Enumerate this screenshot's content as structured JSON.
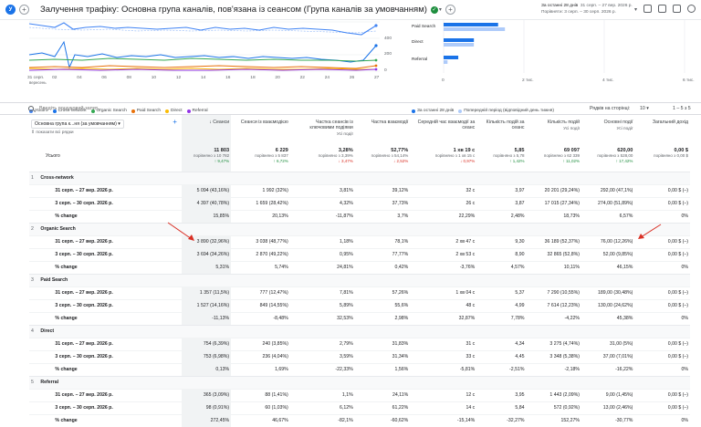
{
  "header": {
    "logo_letter": "У",
    "plus": "+",
    "title": "Залучення трафіку: Основна група каналів, пов'язана із сеансом (Група каналів за умовчанням)",
    "check": "✓",
    "caret": "▾",
    "date_current_label": "За останні 28 днів",
    "date_current": "31 серп. – 27 вер. 2026 р.",
    "date_prev_label": "Порівняти",
    "date_prev": "3 серп. – 30 серп. 2026 р."
  },
  "line_chart": {
    "x_ticks": [
      "31 серп.",
      "02",
      "04",
      "06",
      "08",
      "10",
      "12",
      "14",
      "16",
      "18",
      "20",
      "22",
      "24",
      "26",
      "27"
    ],
    "x_sublabel": "вересень",
    "series": [
      {
        "name": "Усього",
        "color": "#4285f4"
      },
      {
        "name": "Cross-network",
        "color": "#1a73e8"
      },
      {
        "name": "Organic Search",
        "color": "#34a853"
      },
      {
        "name": "Paid Search",
        "color": "#e8710a"
      },
      {
        "name": "Direct",
        "color": "#fbbc04"
      },
      {
        "name": "Referral",
        "color": "#9334e6"
      }
    ]
  },
  "bar_chart": {
    "y_ticks": [
      "400",
      "200",
      "0"
    ],
    "categories": [
      "Paid Search",
      "Direct",
      "Referral"
    ],
    "current": [
      1357,
      754,
      365
    ],
    "previous": [
      1527,
      753,
      98
    ],
    "x_ticks": [
      "0",
      "2 тис.",
      "4 тис.",
      "6 тис."
    ],
    "legend_current": "За останні 28 днів",
    "legend_prev": "Попередній період (відповідний день тижня)",
    "colors": {
      "current": "#1a73e8",
      "previous": "#aecbfa"
    }
  },
  "toolbar": {
    "search_placeholder": "Введіть пошуковий запит...",
    "rows_label": "Рядків на сторінці:",
    "rows_value": "10",
    "pager": "1 – 5 з 5"
  },
  "table": {
    "dim_header": "Основна група к...ня (за умовчанням)",
    "show_all": "показати всі рядки",
    "columns": [
      {
        "title": "Сеанси",
        "sub": ""
      },
      {
        "title": "Сеанси із взаємодією",
        "sub": ""
      },
      {
        "title": "Частка сеансів із ключовими подіями",
        "sub": "Усі події"
      },
      {
        "title": "Частка взаємодії",
        "sub": ""
      },
      {
        "title": "Середній час взаємодії за сеанс",
        "sub": ""
      },
      {
        "title": "Кількість подій за сеанс",
        "sub": ""
      },
      {
        "title": "Кількість подій",
        "sub": "Усі події"
      },
      {
        "title": "Основні події",
        "sub": "Усі події"
      },
      {
        "title": "Загальний дохід",
        "sub": ""
      }
    ],
    "total": {
      "label": "Усього",
      "values": [
        "11 803",
        "6 229",
        "3,28%",
        "52,77%",
        "1 хв 19 с",
        "5,85",
        "69 097",
        "620,00",
        "0,00 $"
      ],
      "compare": [
        "порівняно з 10 782",
        "порівняно з 5 837",
        "порівняно з 3,39%",
        "порівняно з 54,14%",
        "порівняно з 1 хв 15 с",
        "порівняно з 5,78",
        "порівняно з 62 339",
        "порівняно з 528,00",
        "порівняно з 0,00 $"
      ],
      "change": [
        "↑ 9,47%",
        "↑ 6,72%",
        "↓ 3,47%",
        "↓ 2,52%",
        "↓ 0,97%",
        "↑ 1,42%",
        "↑ 11,02%",
        "↑ 17,42%",
        ""
      ],
      "dir": [
        "up",
        "up",
        "down",
        "down",
        "down",
        "up",
        "up",
        "up",
        ""
      ]
    },
    "groups": [
      {
        "idx": "1",
        "name": "Cross-network",
        "rows": [
          {
            "label": "31 серп. – 27 вер. 2026 р.",
            "values": [
              "5 094 (43,16%)",
              "1 992 (32%)",
              "3,81%",
              "39,12%",
              "32 с",
              "3,97",
              "20 201 (29,24%)",
              "292,00 (47,1%)",
              "0,00 $ (–)"
            ]
          },
          {
            "label": "3 серп. – 30 серп. 2026 р.",
            "values": [
              "4 397 (40,78%)",
              "1 659 (28,42%)",
              "4,32%",
              "37,73%",
              "26 с",
              "3,87",
              "17 015 (27,34%)",
              "274,00 (51,89%)",
              "0,00 $ (–)"
            ]
          },
          {
            "label": "% change",
            "values": [
              "15,85%",
              "20,13%",
              "-11,87%",
              "3,7%",
              "22,29%",
              "2,48%",
              "18,73%",
              "6,57%",
              "0%"
            ]
          }
        ]
      },
      {
        "idx": "2",
        "name": "Organic Search",
        "rows": [
          {
            "label": "31 серп. – 27 вер. 2026 р.",
            "values": [
              "3 890 (32,96%)",
              "3 038 (48,77%)",
              "1,18%",
              "78,1%",
              "2 хв 47 с",
              "9,30",
              "36 189 (52,37%)",
              "76,00 (12,26%)",
              "0,00 $ (–)"
            ]
          },
          {
            "label": "3 серп. – 30 серп. 2026 р.",
            "values": [
              "3 694 (34,26%)",
              "2 870 (49,22%)",
              "0,95%",
              "77,77%",
              "2 хв 53 с",
              "8,90",
              "32 865 (52,8%)",
              "52,00 (9,85%)",
              "0,00 $ (–)"
            ]
          },
          {
            "label": "% change",
            "values": [
              "5,31%",
              "5,74%",
              "24,81%",
              "0,42%",
              "-3,76%",
              "4,57%",
              "10,11%",
              "46,15%",
              "0%"
            ]
          }
        ]
      },
      {
        "idx": "3",
        "name": "Paid Search",
        "rows": [
          {
            "label": "31 серп. – 27 вер. 2026 р.",
            "values": [
              "1 357 (11,5%)",
              "777 (12,47%)",
              "7,81%",
              "57,26%",
              "1 хв 04 с",
              "5,37",
              "7 290 (10,55%)",
              "189,00 (30,48%)",
              "0,00 $ (–)"
            ]
          },
          {
            "label": "3 серп. – 30 серп. 2026 р.",
            "values": [
              "1 527 (14,16%)",
              "849 (14,55%)",
              "5,89%",
              "55,6%",
              "48 с",
              "4,99",
              "7 614 (12,23%)",
              "130,00 (24,62%)",
              "0,00 $ (–)"
            ]
          },
          {
            "label": "% change",
            "values": [
              "-11,13%",
              "-8,48%",
              "32,53%",
              "2,98%",
              "32,87%",
              "7,78%",
              "-4,22%",
              "45,38%",
              "0%"
            ]
          }
        ]
      },
      {
        "idx": "4",
        "name": "Direct",
        "rows": [
          {
            "label": "31 серп. – 27 вер. 2026 р.",
            "values": [
              "754 (6,39%)",
              "240 (3,85%)",
              "2,79%",
              "31,83%",
              "31 с",
              "4,34",
              "3 275 (4,74%)",
              "31,00 (5%)",
              "0,00 $ (–)"
            ]
          },
          {
            "label": "3 серп. – 30 серп. 2026 р.",
            "values": [
              "753 (6,98%)",
              "236 (4,04%)",
              "3,59%",
              "31,34%",
              "33 с",
              "4,45",
              "3 348 (5,38%)",
              "37,00 (7,01%)",
              "0,00 $ (–)"
            ]
          },
          {
            "label": "% change",
            "values": [
              "0,13%",
              "1,69%",
              "-22,33%",
              "1,56%",
              "-5,81%",
              "-2,51%",
              "-2,18%",
              "-16,22%",
              "0%"
            ]
          }
        ]
      },
      {
        "idx": "5",
        "name": "Referral",
        "rows": [
          {
            "label": "31 серп. – 27 вер. 2026 р.",
            "values": [
              "365 (3,09%)",
              "88 (1,41%)",
              "1,1%",
              "24,11%",
              "12 с",
              "3,95",
              "1 443 (2,09%)",
              "9,00 (1,45%)",
              "0,00 $ (–)"
            ]
          },
          {
            "label": "3 серп. – 30 серп. 2026 р.",
            "values": [
              "98 (0,91%)",
              "60 (1,03%)",
              "6,12%",
              "61,22%",
              "14 с",
              "5,84",
              "572 (0,92%)",
              "13,00 (2,46%)",
              "0,00 $ (–)"
            ]
          },
          {
            "label": "% change",
            "values": [
              "272,45%",
              "46,67%",
              "-82,1%",
              "-60,62%",
              "-15,14%",
              "-32,27%",
              "152,27%",
              "-30,77%",
              "0%"
            ]
          }
        ]
      }
    ]
  }
}
